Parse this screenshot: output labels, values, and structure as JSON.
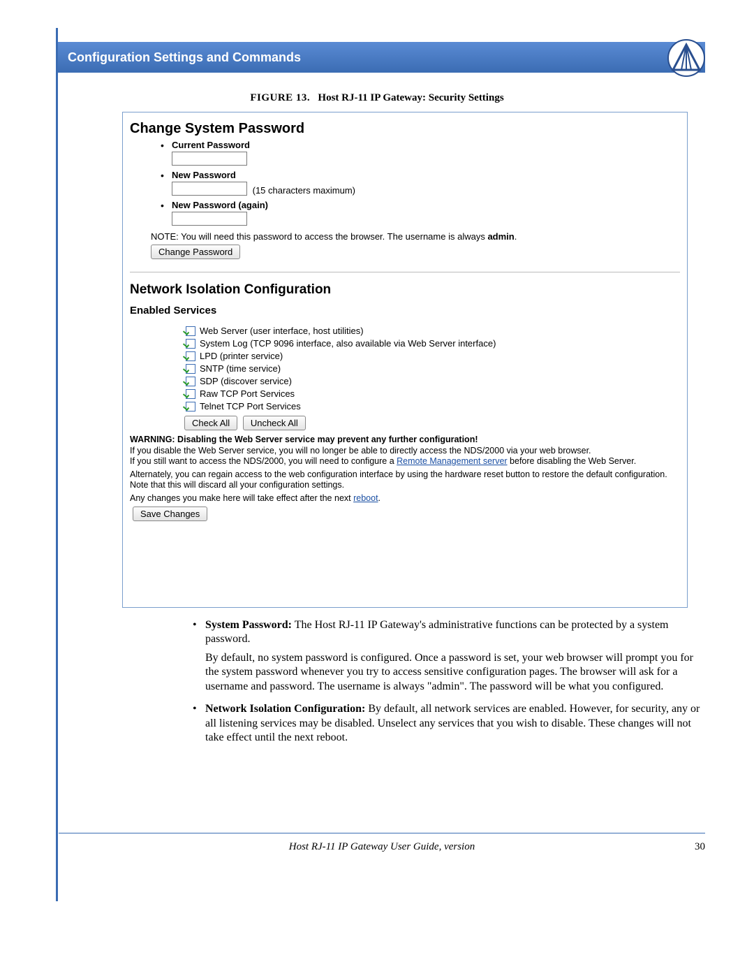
{
  "header": {
    "title": "Configuration Settings and Commands"
  },
  "figure": {
    "label": "FIGURE 13.",
    "title": "Host RJ-11 IP Gateway: Security Settings"
  },
  "screenshot": {
    "password_section": {
      "heading": "Change System Password",
      "fields": {
        "current": {
          "label": "Current Password"
        },
        "new": {
          "label": "New Password",
          "hint": "(15 characters maximum)"
        },
        "again": {
          "label": "New Password (again)"
        }
      },
      "note_prefix": "NOTE: You will need this password to access the browser. The username is always ",
      "note_admin": "admin",
      "note_suffix": ".",
      "change_button": "Change Password"
    },
    "isolation_section": {
      "heading": "Network Isolation Configuration",
      "subheading": "Enabled Services",
      "services": [
        "Web Server (user interface, host utilities)",
        "System Log (TCP 9096 interface, also available via Web Server interface)",
        "LPD (printer service)",
        "SNTP (time service)",
        "SDP (discover service)",
        "Raw TCP Port Services",
        "Telnet TCP Port Services"
      ],
      "check_all": "Check All",
      "uncheck_all": "Uncheck All",
      "warning": "WARNING: Disabling the Web Server service may prevent any further configuration!",
      "p1a": "If you disable the Web Server service, you will no longer be able to directly access the NDS/2000 via your web browser.",
      "p1b_pre": "If you still want to access the NDS/2000, you will need to configure a ",
      "p1b_link": "Remote Management server",
      "p1b_post": " before disabling the Web Server.",
      "p2": "Alternately, you can regain access to the web configuration interface by using the hardware reset button to restore the default configuration. Note that this will discard all your configuration settings.",
      "p3_pre": "Any changes you make here will take effect after the next ",
      "p3_link": "reboot",
      "p3_post": ".",
      "save_button": "Save Changes"
    }
  },
  "body": {
    "item1": {
      "label": "System Password:",
      "text": " The Host RJ-11 IP Gateway's administrative functions can be protected by a system password.",
      "para2": "By default, no system password is configured. Once a password is set, your web browser will prompt you for the system password whenever you try to access sensitive configuration pages. The browser will ask for a username and password. The username is always \"admin\". The password will be what you configured."
    },
    "item2": {
      "label": "Network Isolation Configuration:",
      "text": " By default, all network services are enabled. However, for security, any or all listening services may be disabled. Unselect any services that you wish to disable. These changes will not take effect until the next reboot."
    }
  },
  "footer": {
    "title": "Host RJ-11 IP Gateway User Guide, version",
    "page": "30"
  }
}
